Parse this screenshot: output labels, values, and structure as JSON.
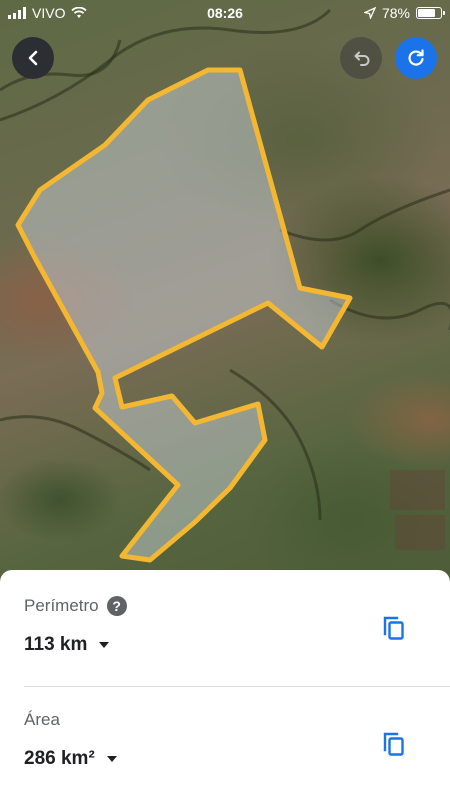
{
  "status_bar": {
    "carrier": "VIVO",
    "time": "08:26",
    "battery_text": "78%",
    "battery_level": 0.78
  },
  "toolbar": {
    "back_icon": "chevron-left-icon",
    "undo_icon": "undo-icon",
    "refresh_icon": "refresh-icon"
  },
  "map": {
    "polygon_color": "#f4b731",
    "polygon_fill": "rgba(210,220,230,0.45)"
  },
  "measurements": {
    "perimeter": {
      "label": "Perímetro",
      "value": "113 km",
      "help_icon": "?"
    },
    "area": {
      "label": "Área",
      "value": "286 km²"
    }
  },
  "colors": {
    "accent": "#1a73e8",
    "dark_button": "#2b2f33"
  }
}
